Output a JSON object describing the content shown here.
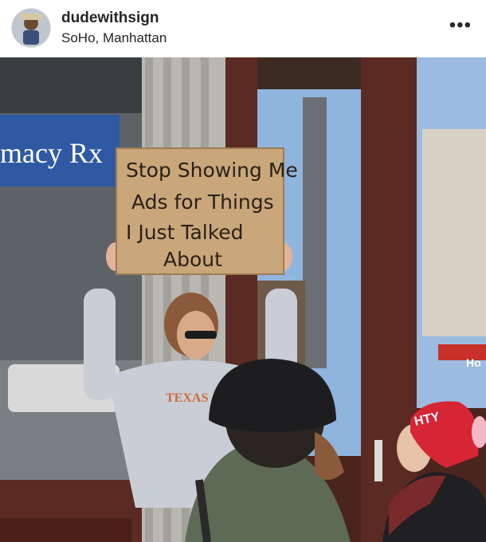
{
  "post": {
    "username": "dudewithsign",
    "location": "SoHo, Manhattan",
    "more_icon": "more-options-icon",
    "more_glyph": "•••"
  },
  "photo": {
    "sign_lines": [
      "Stop Showing Me",
      "Ads for Things",
      "I Just Talked",
      "About"
    ],
    "store_sign": "macy Rx",
    "sweatshirt_text": "TEXAS",
    "hat_text": "HTY",
    "awning_text": "Ho"
  },
  "colors": {
    "cardboard": "#c9a77a",
    "storefront_wood": "#5b2a22",
    "sweatshirt": "#c9ced6",
    "beanie": "#1d1d1f",
    "red_hat": "#d62535",
    "jacket_green": "#5d6a55",
    "sky_reflection": "#8fb4de"
  }
}
